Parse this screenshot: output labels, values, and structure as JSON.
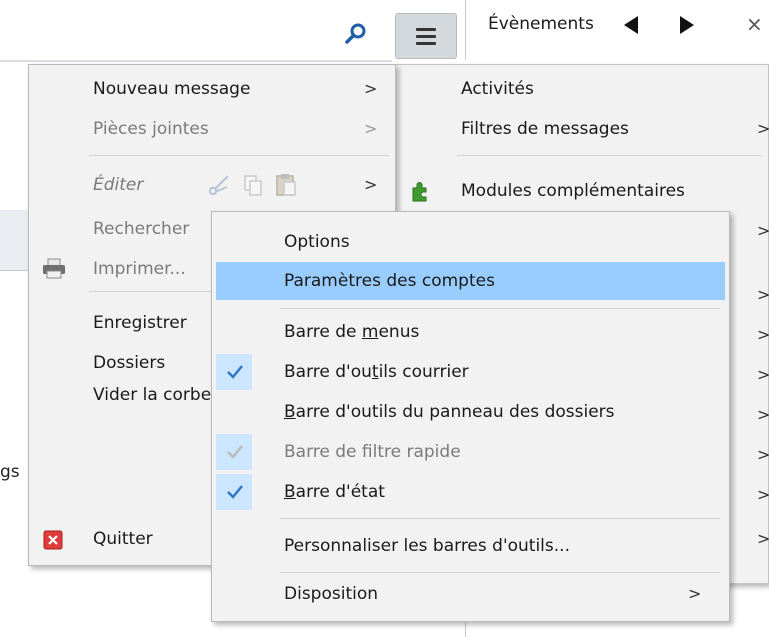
{
  "app": {
    "tab_title": "Évènements",
    "tab_close": "×",
    "bg_fragment": "gs"
  },
  "menu_left": {
    "items": [
      {
        "label": "Nouveau message",
        "arrow": ">"
      },
      {
        "label": "Pièces jointes",
        "arrow": ">"
      },
      {
        "label": "Éditer",
        "arrow": ">"
      },
      {
        "label": "Rechercher"
      },
      {
        "label": "Imprimer..."
      },
      {
        "label": "Enregistrer"
      },
      {
        "label": "Dossiers"
      },
      {
        "label": "Vider la corbeille"
      },
      {
        "label": "Quitter"
      }
    ]
  },
  "menu_right": {
    "items": [
      {
        "label": "Activités"
      },
      {
        "label": "Filtres de messages",
        "arrow": ">"
      },
      {
        "label": "Modules complémentaires"
      }
    ],
    "arrows": [
      ">",
      ">",
      ">",
      ">",
      ">",
      ">",
      ">",
      ">"
    ]
  },
  "menu_front": {
    "items": [
      {
        "label": "Options"
      },
      {
        "label": "Paramètres des comptes"
      },
      {
        "pre": "Barre de ",
        "acc": "m",
        "post": "enus"
      },
      {
        "pre": "Barre d'ou",
        "acc": "t",
        "post": "ils courrier"
      },
      {
        "pre": "",
        "acc": "B",
        "post": "arre d'outils du panneau des dossiers"
      },
      {
        "label": "Barre de filtre rapide"
      },
      {
        "pre": "",
        "acc": "B",
        "post": "arre d'état"
      },
      {
        "label": "Personnaliser les barres d'outils..."
      },
      {
        "label": "Disposition",
        "arrow": ">"
      }
    ],
    "highlighted": "Paramètres des comptes"
  },
  "colors": {
    "highlight": "#99ccff",
    "check_blue": "#2f74c4",
    "menu_bg": "#f2f2f2"
  },
  "icons": [
    "search-icon",
    "hamburger-menu-icon",
    "scissors-icon",
    "copy-icon",
    "paste-icon",
    "printer-icon",
    "puzzle-icon",
    "quit-icon",
    "checkmark-icon"
  ]
}
